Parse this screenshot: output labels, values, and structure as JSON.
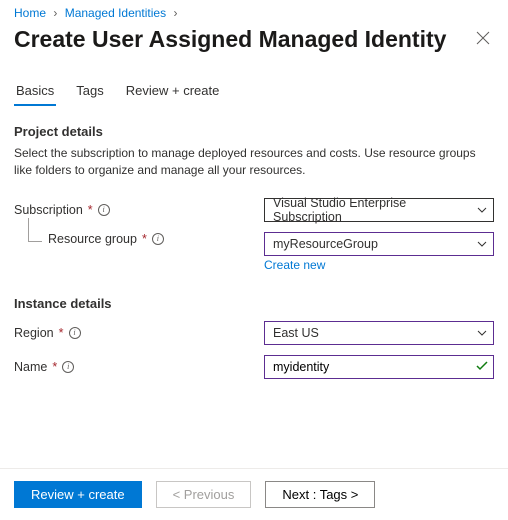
{
  "breadcrumb": {
    "home": "Home",
    "parent": "Managed Identities"
  },
  "title": "Create User Assigned Managed Identity",
  "tabs": {
    "basics": "Basics",
    "tags": "Tags",
    "review": "Review + create"
  },
  "project": {
    "heading": "Project details",
    "description": "Select the subscription to manage deployed resources and costs. Use resource groups like folders to organize and manage all your resources.",
    "subscription_label": "Subscription",
    "subscription_value": "Visual Studio Enterprise Subscription",
    "resource_group_label": "Resource group",
    "resource_group_value": "myResourceGroup",
    "create_new": "Create new"
  },
  "instance": {
    "heading": "Instance details",
    "region_label": "Region",
    "region_value": "East US",
    "name_label": "Name",
    "name_value": "myidentity"
  },
  "footer": {
    "review": "Review + create",
    "previous": "< Previous",
    "next": "Next : Tags >"
  }
}
